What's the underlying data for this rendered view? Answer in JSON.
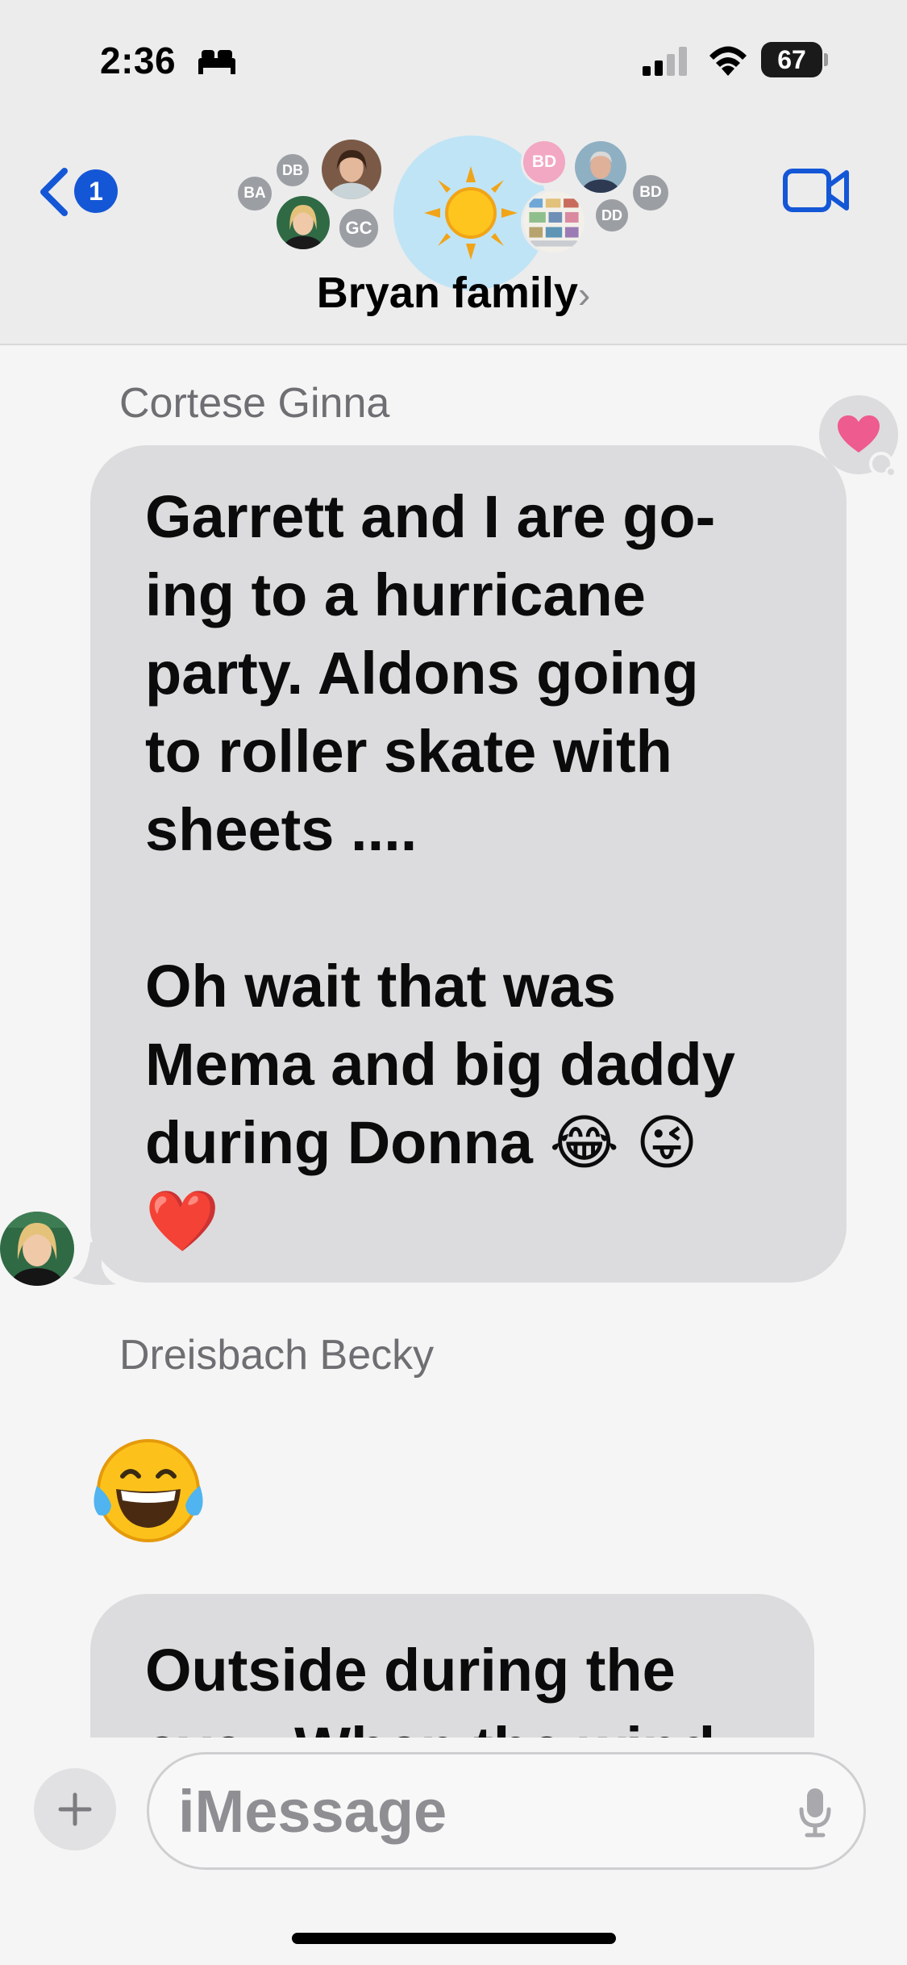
{
  "status_bar": {
    "time": "2:36",
    "battery": "67",
    "icons": [
      "bed-icon",
      "cellular-signal-icon",
      "wifi-icon",
      "battery-icon"
    ]
  },
  "header": {
    "back_badge": "1",
    "group_name": "Bryan family",
    "group_chevron": "›",
    "avatars": {
      "ba": "BA",
      "db": "DB",
      "gc": "GC",
      "bd_pink": "BD",
      "dd": "DD",
      "bd_right": "BD"
    }
  },
  "messages": [
    {
      "sender": "Cortese Ginna",
      "text": "Garrett and I are go-\ning to a hurricane\nparty. Aldons going\nto roller skate with\nsheets ....\n\nOh wait that was\nMema and big daddy\nduring Donna 😂 😜\n❤️",
      "tapback": "heart"
    },
    {
      "sender": "Dreisbach Becky",
      "emoji": "😂",
      "text": "Outside during the\neye . When the wind"
    }
  ],
  "input": {
    "placeholder": "iMessage"
  },
  "colors": {
    "accent_blue": "#1457d6",
    "bubble_gray": "#dcdcde",
    "header_bg": "#ececec",
    "heart_pink": "#ee5b8f"
  }
}
